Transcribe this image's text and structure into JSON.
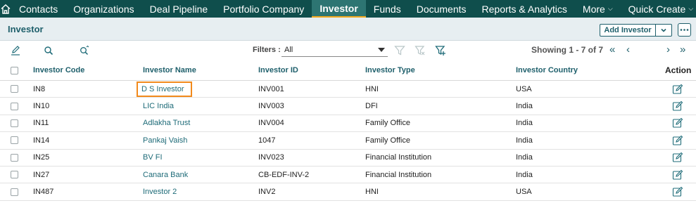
{
  "nav": {
    "items": [
      {
        "label": "Contacts"
      },
      {
        "label": "Organizations"
      },
      {
        "label": "Deal Pipeline"
      },
      {
        "label": "Portfolio Company"
      },
      {
        "label": "Investor",
        "active": true
      },
      {
        "label": "Funds"
      },
      {
        "label": "Documents"
      },
      {
        "label": "Reports & Analytics"
      },
      {
        "label": "More",
        "dropdown": true
      },
      {
        "label": "Quick Create",
        "dropdown": true
      }
    ]
  },
  "header": {
    "title": "Investor",
    "add_button": "Add Investor"
  },
  "toolbar": {
    "filters_label": "Filters :",
    "filter_value": "All",
    "showing": "Showing 1 - 7 of 7"
  },
  "table": {
    "columns": [
      "Investor Code",
      "Investor Name",
      "Investor ID",
      "Investor Type",
      "Investor Country",
      "Action"
    ],
    "rows": [
      {
        "code": "IN8",
        "name": "D S Investor",
        "id": "INV001",
        "type": "HNI",
        "country": "USA"
      },
      {
        "code": "IN10",
        "name": "LIC India",
        "id": "INV003",
        "type": "DFI",
        "country": "India"
      },
      {
        "code": "IN11",
        "name": "Adlakha Trust",
        "id": "INV004",
        "type": "Family Office",
        "country": "India"
      },
      {
        "code": "IN14",
        "name": "Pankaj Vaish",
        "id": "1047",
        "type": "Family Office",
        "country": "India"
      },
      {
        "code": "IN25",
        "name": "BV FI",
        "id": "INV023",
        "type": "Financial Institution",
        "country": "India"
      },
      {
        "code": "IN27",
        "name": "Canara Bank",
        "id": "CB-EDF-INV-2",
        "type": "Financial Institution",
        "country": "India"
      },
      {
        "code": "IN487",
        "name": "Investor 2",
        "id": "INV2",
        "type": "HNI",
        "country": "USA"
      }
    ]
  },
  "colors": {
    "nav_bg": "#0f4e4c",
    "nav_active": "#2d7572",
    "accent": "#1e5f6b",
    "highlight": "#f28a1c"
  }
}
